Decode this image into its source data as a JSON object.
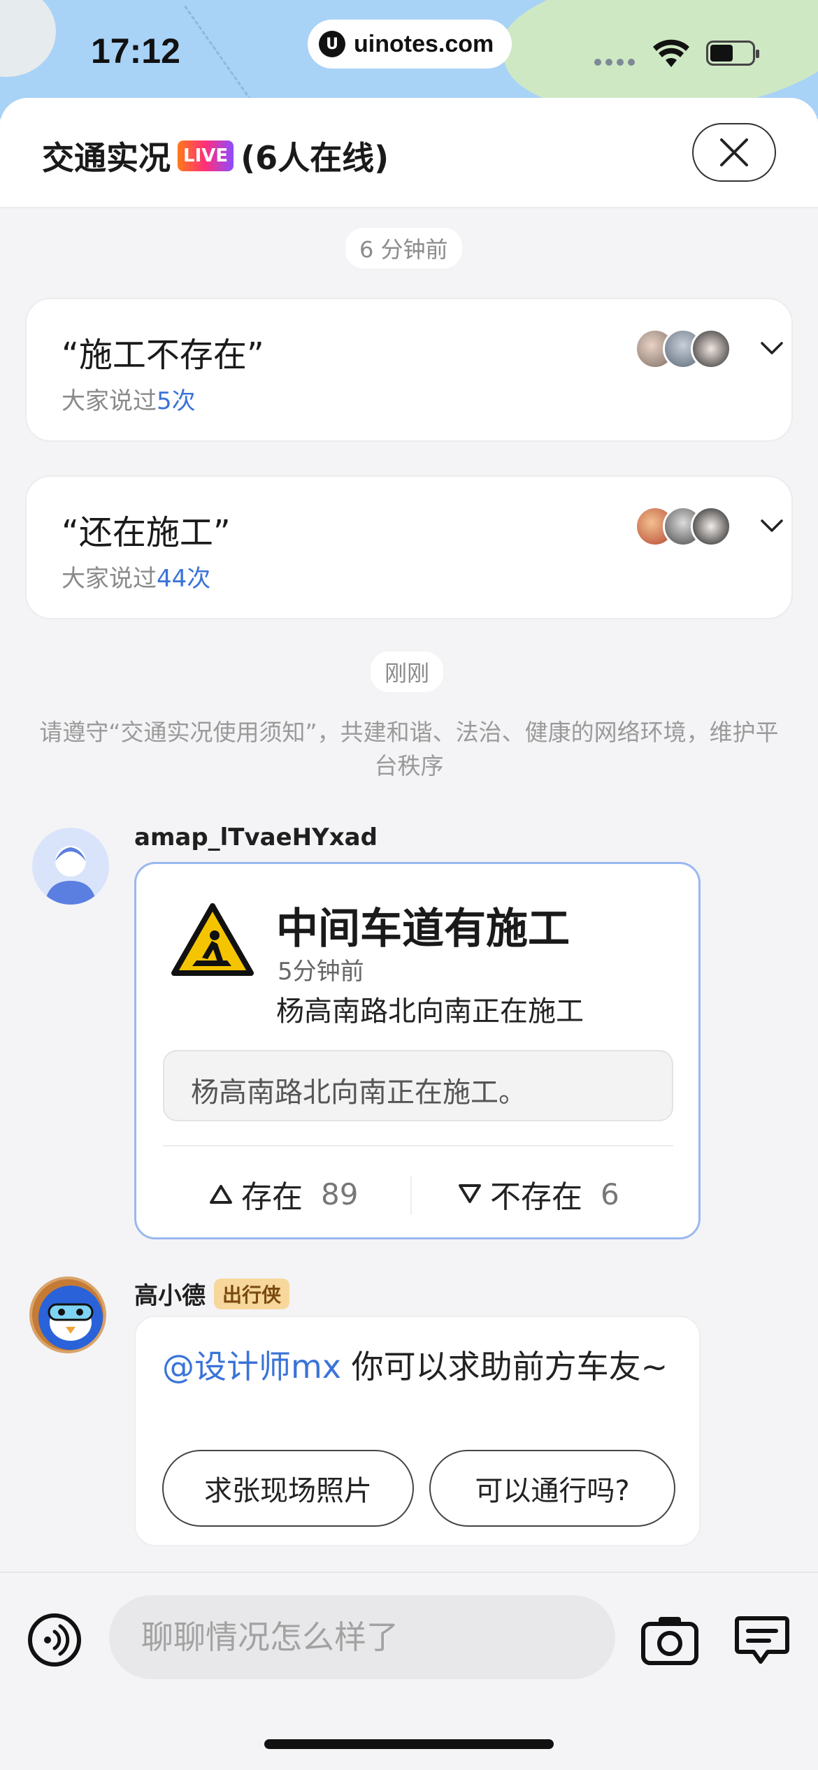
{
  "status_bar": {
    "time": "17:12",
    "url": "uinotes.com"
  },
  "header": {
    "title_prefix": "交通实况",
    "live_badge": "LIVE",
    "title_suffix": "(6人在线)"
  },
  "timeline": [
    {
      "label": "6 分钟前"
    },
    {
      "label": "刚刚"
    }
  ],
  "feedback_cards": [
    {
      "quote": "“施工不存在”",
      "sub_prefix": "大家说过",
      "count": "5次"
    },
    {
      "quote": "“还在施工”",
      "sub_prefix": "大家说过",
      "count": "44次"
    }
  ],
  "notice": "请遵守“交通实况使用须知”，共建和谐、法治、健康的网络环境，维护平台秩序",
  "report": {
    "user_name": "amap_lTvaeHYxad",
    "title": "中间车道有施工",
    "time": "5分钟前",
    "description": "杨高南路北向南正在施工",
    "comment": "杨高南路北向南正在施工。",
    "vote_exist_label": "存在",
    "vote_exist_count": "89",
    "vote_not_exist_label": "不存在",
    "vote_not_exist_count": "6"
  },
  "bot": {
    "name": "高小德",
    "tag": "出行侠",
    "mention": "@设计师mx",
    "message": " 你可以求助前方车友~",
    "quick_replies": [
      "求张现场照片",
      "可以通行吗?"
    ]
  },
  "input": {
    "placeholder": "聊聊情况怎么样了"
  },
  "colors": {
    "accent_blue": "#3a73d8",
    "card_border": "#9ab8ef",
    "tag_bg": "#f7d79b"
  }
}
